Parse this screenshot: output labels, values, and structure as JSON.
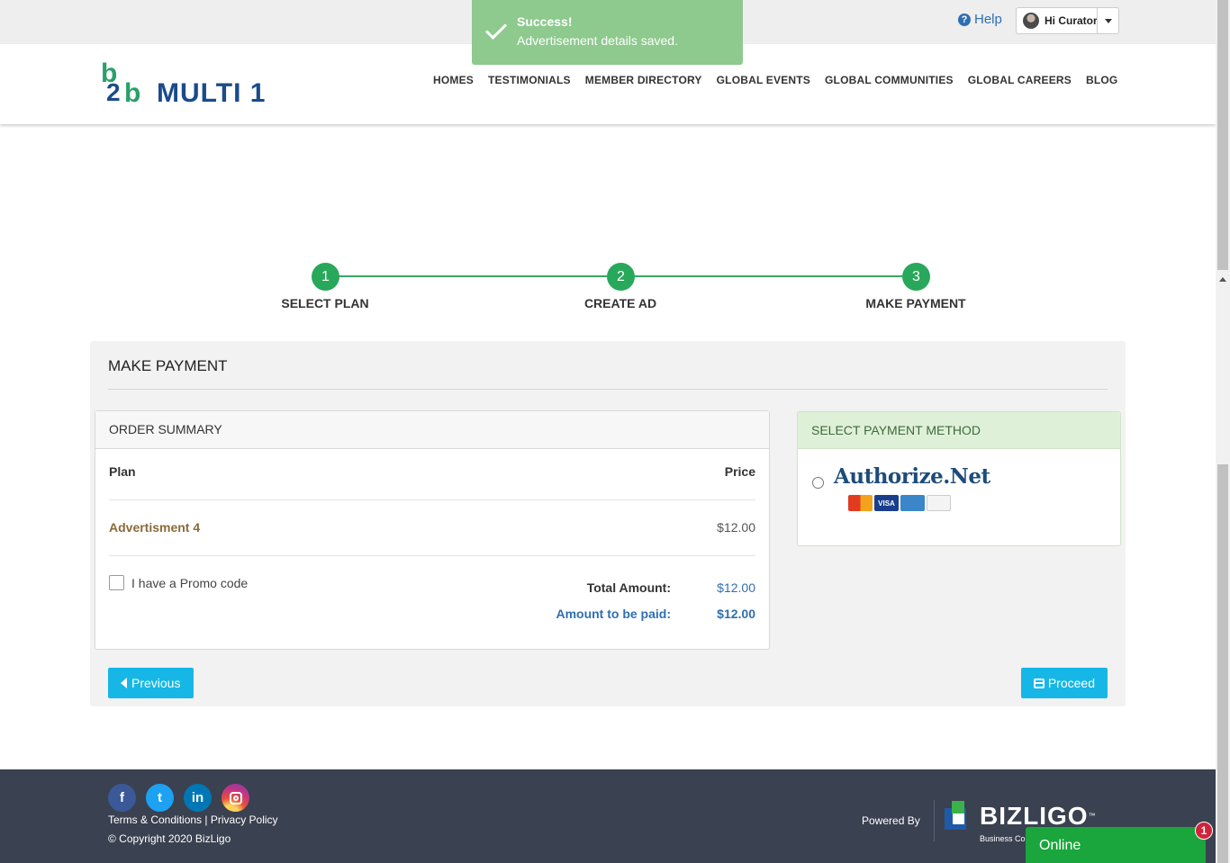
{
  "topbar": {
    "help_label": "Help",
    "help_icon": "question-circle-icon",
    "user_label": "Hi Curator"
  },
  "toast": {
    "title": "Success!",
    "message": "Advertisement details saved."
  },
  "header": {
    "logo_text": "MULTI 1",
    "logo_mark_parts": [
      "b",
      "2",
      "b"
    ],
    "nav": [
      "HOMES",
      "TESTIMONIALS",
      "MEMBER DIRECTORY",
      "GLOBAL EVENTS",
      "GLOBAL COMMUNITIES",
      "GLOBAL CAREERS",
      "BLOG"
    ]
  },
  "steps": [
    {
      "number": "1",
      "label": "SELECT PLAN"
    },
    {
      "number": "2",
      "label": "CREATE AD"
    },
    {
      "number": "3",
      "label": "MAKE PAYMENT"
    }
  ],
  "payment": {
    "title": "MAKE PAYMENT",
    "order_summary": {
      "heading": "ORDER SUMMARY",
      "col_plan": "Plan",
      "col_price": "Price",
      "plan_name": "Advertisment 4",
      "plan_price": "$12.00",
      "promo_label": "I have a Promo code",
      "total_label": "Total Amount:",
      "total_value": "$12.00",
      "pay_label": "Amount to be paid:",
      "pay_value": "$12.00"
    },
    "method": {
      "heading": "SELECT PAYMENT METHOD",
      "provider": "Authorize.Net",
      "card_labels": [
        "MasterCard",
        "VISA",
        "AMEX",
        "DISCOVER"
      ]
    },
    "buttons": {
      "previous": "Previous",
      "proceed": "Proceed"
    }
  },
  "footer": {
    "social_icons": [
      "facebook-icon",
      "twitter-icon",
      "linkedin-icon",
      "instagram-icon"
    ],
    "social_glyphs": [
      "f",
      "t",
      "in"
    ],
    "terms": "Terms & Conditions",
    "separator": "|",
    "privacy": "Privacy Policy",
    "copyright": "© Copyright 2020 BizLigo",
    "powered_by": "Powered By",
    "brand": "BIZLIGO",
    "brand_tm": "™",
    "brand_sub": "Business Co"
  },
  "chat": {
    "label": "Online",
    "badge": "1"
  },
  "colors": {
    "accent": "#16b7e6",
    "step_green": "#28a85b",
    "toast_green": "#8ec98e",
    "footer_bg": "#3a4150",
    "chat_green": "#1aa63c",
    "link_blue": "#2f6fb0"
  }
}
